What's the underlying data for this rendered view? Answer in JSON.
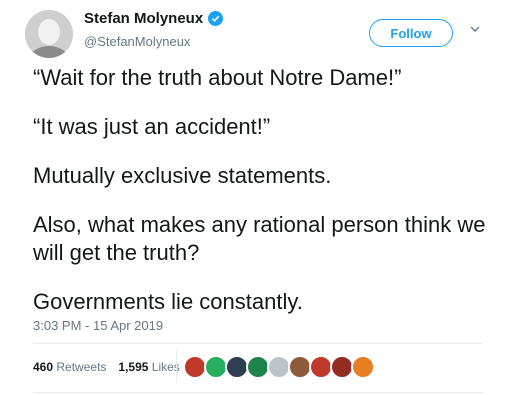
{
  "user": {
    "name": "Stefan Molyneux",
    "handle": "@StefanMolyneux",
    "verified": true
  },
  "actions": {
    "follow_label": "Follow"
  },
  "tweet": {
    "paragraphs": [
      "“Wait for the truth about Notre Dame!”",
      "“It was just an accident!”",
      "Mutually exclusive statements.",
      "Also, what makes any rational person think we will get the truth?",
      "Governments lie constantly."
    ],
    "timestamp": "3:03 PM - 15 Apr 2019"
  },
  "stats": {
    "retweets_count": "460",
    "retweets_label": "Retweets",
    "likes_count": "1,595",
    "likes_label": "Likes"
  },
  "likers": [
    {
      "color": "#c0392b"
    },
    {
      "color": "#27ae60"
    },
    {
      "color": "#2c3e50"
    },
    {
      "color": "#1e8449"
    },
    {
      "color": "#bdc3c7"
    },
    {
      "color": "#8e5b3a"
    },
    {
      "color": "#c0392b"
    },
    {
      "color": "#922b21"
    },
    {
      "color": "#e67e22"
    }
  ],
  "colors": {
    "accent": "#1da1f2",
    "muted": "#657786"
  }
}
